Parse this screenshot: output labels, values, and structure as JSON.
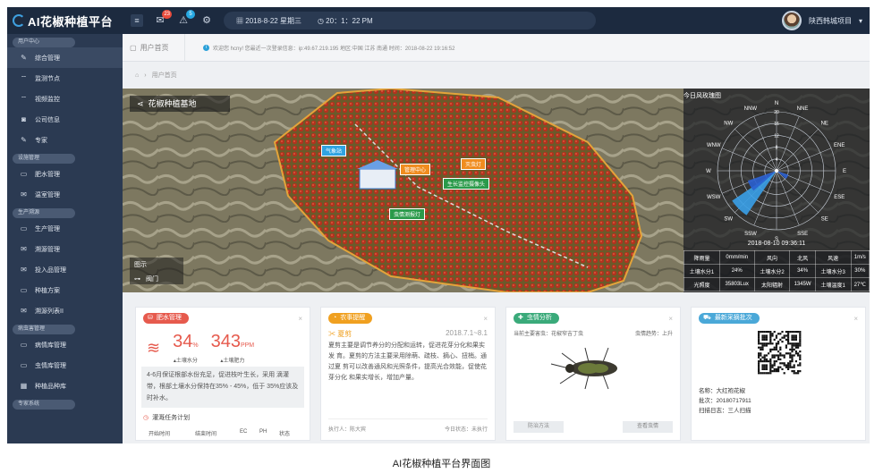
{
  "app": {
    "title": "AI花椒种植平台"
  },
  "topbar": {
    "badges": {
      "messages": "23",
      "alerts": "5"
    },
    "date": "2018-8-22 星期三",
    "time": "20：1：22 PM",
    "user_name": "陕西韩城项目"
  },
  "sidebar": {
    "groups": [
      {
        "label": "用户中心",
        "items": [
          "综合管理",
          "监测节点",
          "视频监控",
          "公司信息",
          "专家"
        ]
      },
      {
        "label": "设施管理",
        "items": [
          "肥水管理",
          "温室管理"
        ]
      },
      {
        "label": "生产溯源",
        "items": [
          "生产管理",
          "溯源管理",
          "投入品管理",
          "种植方案",
          "溯源列表II"
        ]
      },
      {
        "label": "病虫害管理",
        "items": [
          "病情库管理",
          "虫情库管理",
          "种植品种库"
        ]
      },
      {
        "label": "专家系统",
        "items": []
      }
    ],
    "active": "综合管理"
  },
  "tabs": {
    "home": "用户首页"
  },
  "notice": "欢迎您 hcny!  您最近一次登录信息：ip:49.67.219.195 地区:中国 江苏 南通 时间：2018-08-22 19:16:52",
  "breadcrumb": "用户首页",
  "map": {
    "title": "花椒种植基地",
    "legend_title": "图示",
    "legend_item": "阀门",
    "labels": {
      "weather": "气象站",
      "mgmt": "管理中心",
      "lamp": "灭虫灯",
      "camera": "生长监控摄像头",
      "trap": "虫情测报灯"
    }
  },
  "wind": {
    "title": "今日风玫瑰图",
    "directions": [
      "N",
      "NNE",
      "NE",
      "ENE",
      "E",
      "ESE",
      "SE",
      "SSE",
      "S",
      "SSW",
      "SW",
      "WSW",
      "W",
      "WNW",
      "NW",
      "NNW"
    ],
    "radii": [
      "20",
      "16",
      "12",
      "8",
      "4",
      "0"
    ],
    "timestamp": "2018-08-10 09:36:11",
    "rows": [
      [
        "降雨量",
        "0mm/min",
        "风向",
        "北风",
        "风速",
        "1m/s"
      ],
      [
        "土壤水分1",
        "24%",
        "土壤水分2",
        "34%",
        "土壤水分3",
        "30%"
      ],
      [
        "光照度",
        "35803Lux",
        "太阳辐射",
        "1345W",
        "土壤温度1",
        "27℃"
      ]
    ]
  },
  "cards": {
    "fertilizer": {
      "title": "肥水管理",
      "water_value": "34",
      "water_unit": "%",
      "water_label": "土壤水分",
      "fert_value": "343",
      "fert_unit": "PPM",
      "fert_label": "土壤肥力",
      "text": "4-6月保证根部水份充足，促进枝叶生长，采用 滴灌带，根部土壤水分保持在35% - 45%，低于 35%应该及时补水。",
      "plan_title": "灌溉任务计划",
      "columns": [
        "开始时间",
        "结束时间",
        "EC",
        "PH",
        "状态"
      ]
    },
    "farm": {
      "title": "农事提醒",
      "subject": "夏剪",
      "date": "2018.7.1~8.1",
      "text": "夏剪主要是调节养分的分配和运转，促进花芽分化和果实发 育。夏剪的方法主要采用除萌、疏枝、摘心、扭梢。通过夏 剪可以改善通风和光照条件，提高光合效能，促使花芽分化 和果实增长，增加产量。",
      "executor": "执行人：陈大宾",
      "status": "今日状态：未执行"
    },
    "pest": {
      "title": "虫情分析",
      "current": "当前主要害虫：花椒窄吉丁虫",
      "trend": "虫情趋势：上升",
      "btn_method": "防治方法",
      "btn_view": "查看虫情"
    },
    "batch": {
      "title": "最新采摘批次",
      "name": "名称：大红袍花椒",
      "batch": "批次：20180717911",
      "scan": "扫描日志：三人扫描"
    }
  },
  "caption": "AI花椒种植平台界面图",
  "colors": {
    "topbar": "#1c2a3f",
    "sidebar": "#2b3a52",
    "accent_red": "#e65a4d",
    "accent_orange": "#f0a020",
    "accent_green": "#3aaa7a",
    "accent_blue": "#4aa8d8"
  }
}
